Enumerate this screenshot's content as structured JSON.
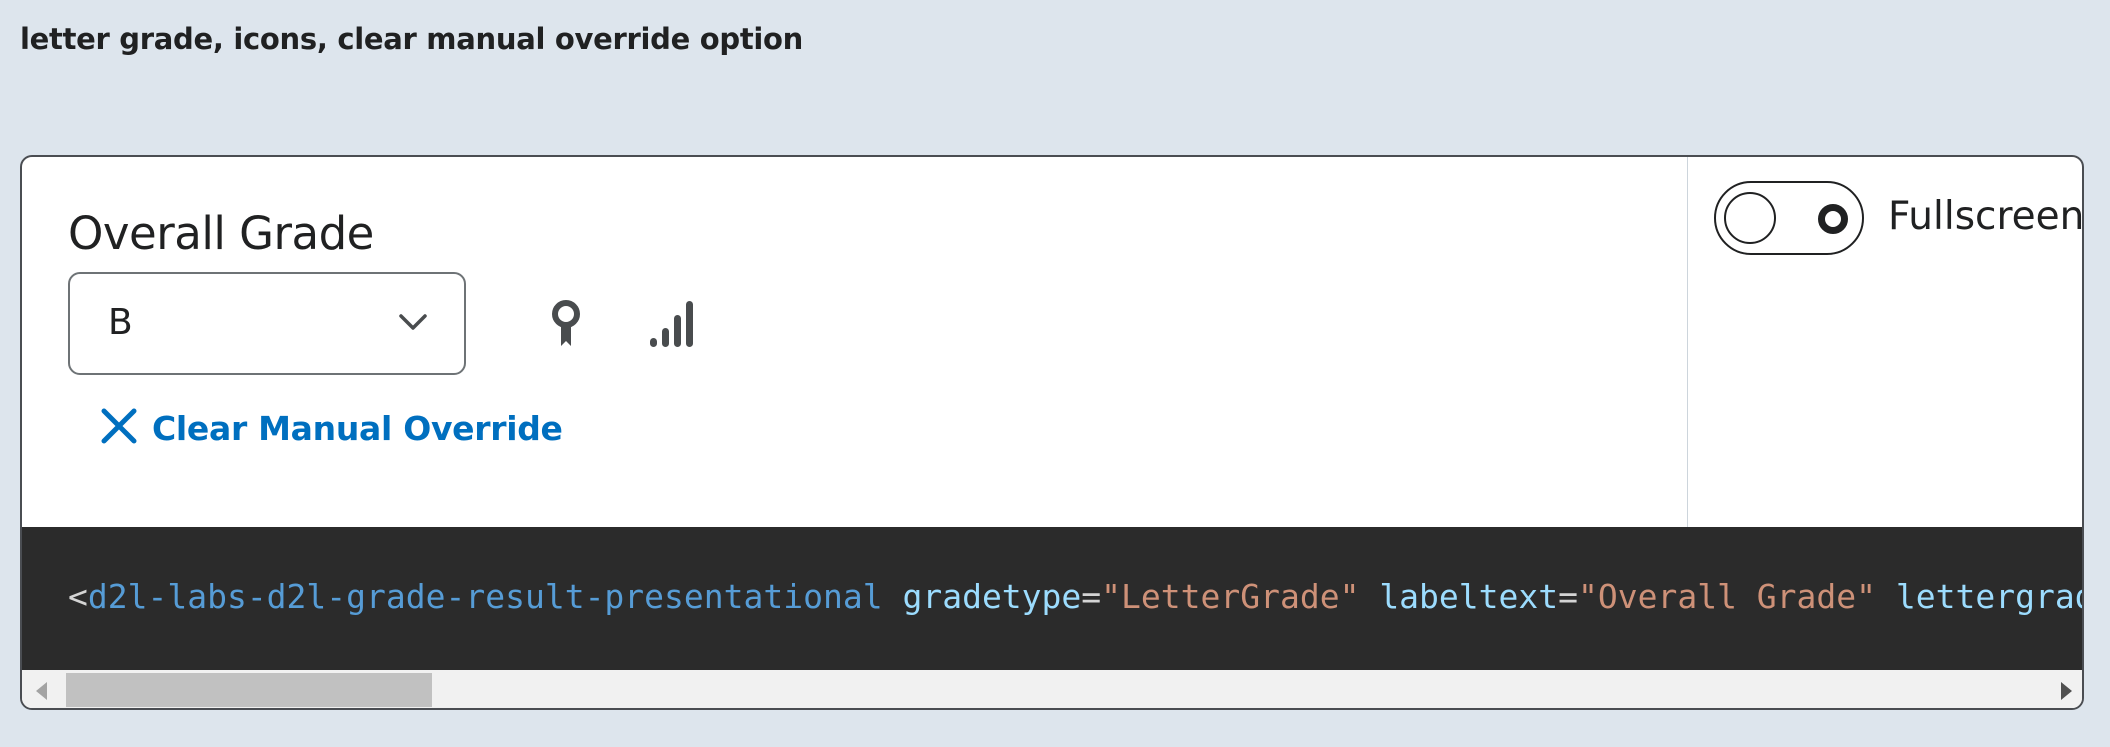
{
  "caption": "letter grade, icons, clear manual override option",
  "grade": {
    "label": "Overall Grade",
    "selected_value": "B",
    "clear_override_label": "Clear Manual Override"
  },
  "icons": {
    "dropdown": "chevron-down-icon",
    "reports": "ribbon-icon",
    "statistics": "stats-bars-icon",
    "clear": "close-icon"
  },
  "fullscreen": {
    "label": "Fullscreen"
  },
  "code": {
    "open_bracket": "<",
    "tag": "d2l-labs-d2l-grade-result-presentational",
    "attr1_name": "gradetype",
    "attr1_value": "\"LetterGrade\"",
    "attr2_name": "labeltext",
    "attr2_value": "\"Overall Grade\"",
    "attr3_name": "lettergrad",
    "equals": "="
  },
  "colors": {
    "page_background": "#dde5ed",
    "link_blue": "#006fbf",
    "code_background": "#2b2b2b",
    "code_tag": "#569cd6",
    "code_attr": "#9cdcfe",
    "code_string": "#ce9178"
  }
}
